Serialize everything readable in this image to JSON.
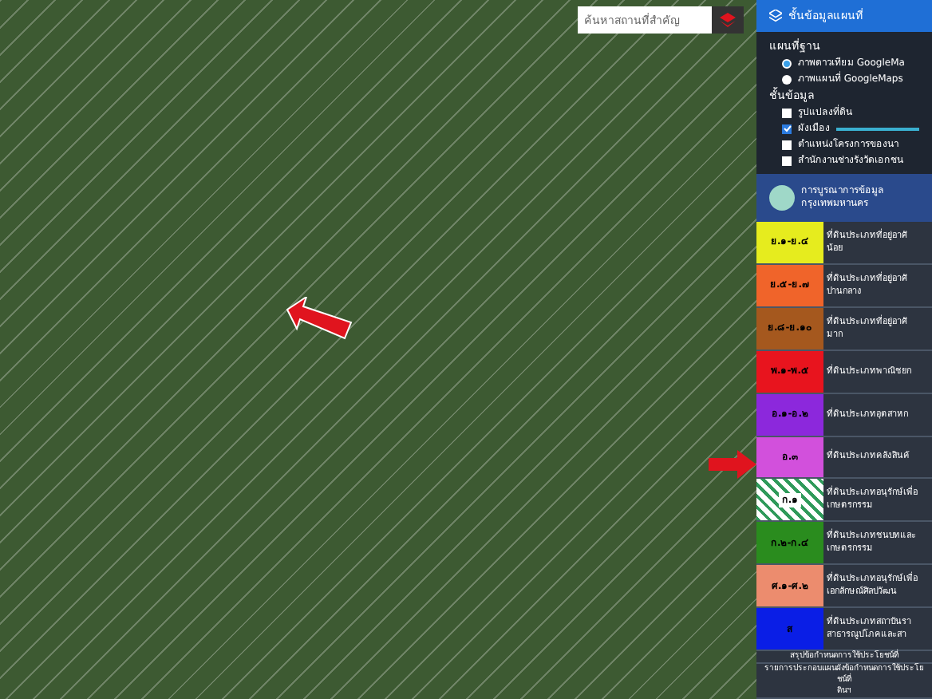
{
  "map": {
    "search": {
      "placeholder": "ค้นหาสถานที่สำคัญ"
    }
  },
  "panel": {
    "title": "ชั้นข้อมูลแผนที่",
    "basemap": {
      "heading": "แผนที่ฐาน",
      "options": [
        {
          "label": "ภาพดาวเทียม GoogleMa",
          "selected": true
        },
        {
          "label": "ภาพแผนที่ GoogleMaps",
          "selected": false
        }
      ]
    },
    "layers": {
      "heading": "ชั้นข้อมูล",
      "items": [
        {
          "label": "รูปแปลงที่ดิน",
          "checked": false
        },
        {
          "label": "ผังเมือง",
          "checked": true,
          "level": 1
        },
        {
          "label": "ตำแหน่งโครงการของนา",
          "checked": false
        },
        {
          "label": "สำนักงานช่างรังวัดเอกชน",
          "checked": false
        }
      ]
    },
    "source": {
      "lines": [
        "การบูรณาการข้อมูล",
        "กรุงเทพมหานคร"
      ]
    },
    "legend": [
      {
        "code": "ย.๑-ย.๔",
        "color": "#e6ec1e",
        "description": "ที่ดินประเภทที่อยู่อาศั",
        "description_2": "น้อย",
        "kind": "solid"
      },
      {
        "code": "ย.๕-ย.๗",
        "color": "#f0642a",
        "description": "ที่ดินประเภทที่อยู่อาศั",
        "description_2": "ปานกลาง",
        "kind": "solid"
      },
      {
        "code": "ย.๘-ย.๑๐",
        "color": "#a5581e",
        "description": "ที่ดินประเภทที่อยู่อาศั",
        "description_2": "มาก",
        "kind": "solid"
      },
      {
        "code": "พ.๑-พ.๕",
        "color": "#e8141e",
        "description": "ที่ดินประเภทพาณิชยก",
        "kind": "solid"
      },
      {
        "code": "อ.๑-อ.๒",
        "color": "#8c28dc",
        "description": "ที่ดินประเภทอุตสาหก",
        "kind": "solid"
      },
      {
        "code": "อ.๓",
        "color": "#d250dc",
        "description": "ที่ดินประเภทคลังสินค้",
        "kind": "solid"
      },
      {
        "code": "ก.๑",
        "color": "#2f9a5a",
        "description": "ที่ดินประเภทอนุรักษ์เพื่อ",
        "description_2": "เกษตรกรรม",
        "kind": "hatched"
      },
      {
        "code": "ก.๒-ก.๔",
        "color": "#2a8c1e",
        "description": "ที่ดินประเภทชนบทและ",
        "description_2": "เกษตรกรรม",
        "kind": "solid"
      },
      {
        "code": "ศ.๑-ศ.๒",
        "color": "#ec8c6e",
        "description": "ที่ดินประเภทอนุรักษ์เพื่อ",
        "description_2": "เอกลักษณ์ศิลปวัฒน",
        "kind": "solid"
      },
      {
        "code": "ส",
        "color": "#0a1ee6",
        "description": "ที่ดินประเภทสถาบันรา",
        "description_2": "สาธารณูปโภคและสา",
        "kind": "solid"
      }
    ],
    "footer": [
      {
        "lines": [
          "สรุปข้อกำหนดการใช้ประโยชน์ที่"
        ]
      },
      {
        "lines": [
          "รายการประกอบแผนผังข้อกำหนดการใช้ประโยชน์ที่",
          "ดินฯ"
        ]
      }
    ]
  }
}
